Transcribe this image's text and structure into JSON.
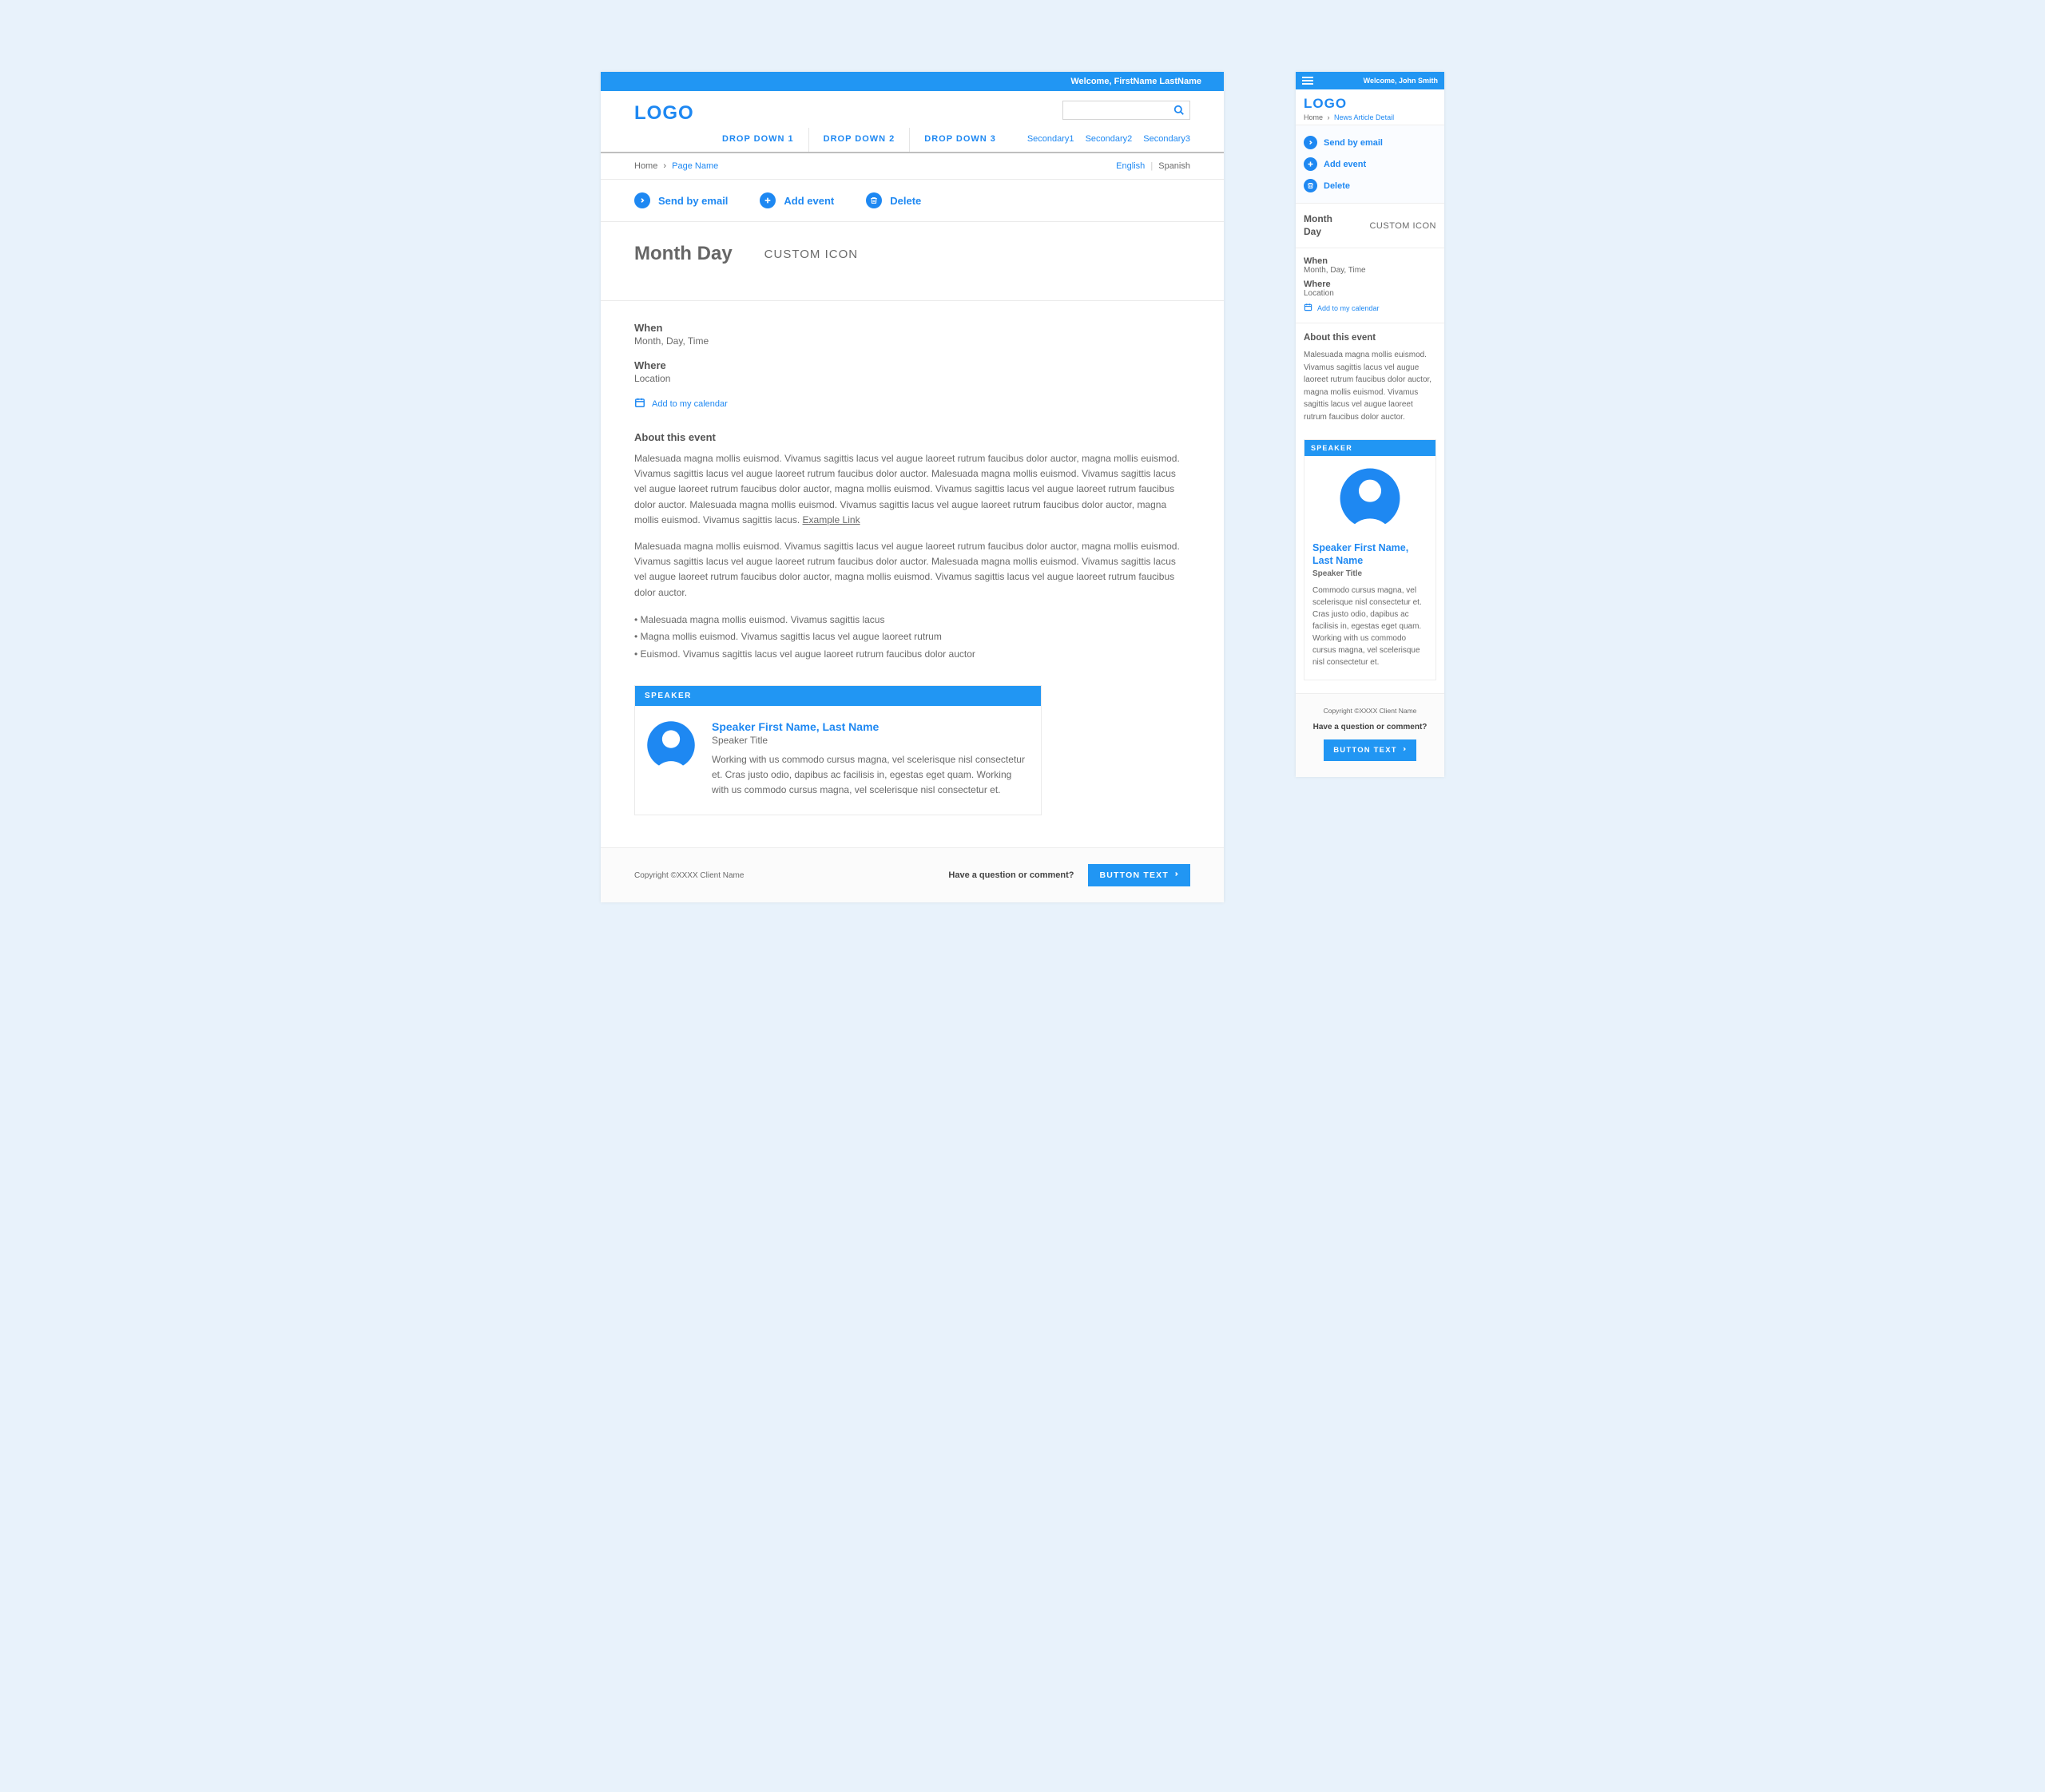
{
  "desktop": {
    "topbar_welcome": "Welcome, FirstName LastName",
    "logo": "LOGO",
    "search_placeholder": "",
    "primary_nav": [
      "DROP DOWN 1",
      "DROP DOWN 2",
      "DROP DOWN 3"
    ],
    "secondary_nav": [
      "Secondary1",
      "Secondary2",
      "Secondary3"
    ],
    "breadcrumb": {
      "home": "Home",
      "sep": "›",
      "page": "Page Name"
    },
    "lang": {
      "active": "English",
      "sep": "|",
      "inactive": "Spanish"
    },
    "actions": {
      "send_label": "Send by email",
      "add_label": "Add event",
      "delete_label": "Delete"
    },
    "title": "Month Day",
    "custom_icon": "CUSTOM ICON",
    "fields": {
      "when_label": "When",
      "when_value": "Month, Day, Time",
      "where_label": "Where",
      "where_value": "Location",
      "calendar_link": "Add to my calendar"
    },
    "about_heading": "About this event",
    "paragraph1": "Malesuada magna mollis euismod. Vivamus sagittis lacus vel augue laoreet rutrum faucibus dolor auctor, magna mollis euismod. Vivamus sagittis lacus vel augue laoreet rutrum faucibus dolor auctor. Malesuada magna mollis euismod. Vivamus sagittis lacus vel augue laoreet rutrum faucibus dolor auctor, magna mollis euismod. Vivamus sagittis lacus vel augue laoreet rutrum faucibus dolor auctor. Malesuada magna mollis euismod. Vivamus sagittis lacus vel augue laoreet rutrum faucibus dolor auctor, magna mollis euismod. Vivamus sagittis lacus. ",
    "paragraph1_link": "Example Link",
    "paragraph2": "Malesuada magna mollis euismod. Vivamus sagittis lacus vel augue laoreet rutrum faucibus dolor auctor, magna mollis euismod. Vivamus sagittis lacus vel augue laoreet rutrum faucibus dolor auctor. Malesuada magna mollis euismod. Vivamus sagittis lacus vel augue laoreet rutrum faucibus dolor auctor, magna mollis euismod. Vivamus sagittis lacus vel augue laoreet rutrum faucibus dolor auctor.",
    "bullets": [
      "Malesuada magna mollis euismod. Vivamus sagittis lacus",
      "Magna mollis euismod. Vivamus sagittis lacus vel augue laoreet rutrum",
      "Euismod. Vivamus sagittis lacus vel augue laoreet rutrum faucibus dolor auctor"
    ],
    "speaker": {
      "heading": "SPEAKER",
      "name": "Speaker First Name, Last Name",
      "title": "Speaker Title",
      "bio": "Working with us commodo cursus magna, vel scelerisque nisl consectetur et. Cras justo odio, dapibus ac facilisis in, egestas eget quam. Working with us commodo cursus magna, vel scelerisque nisl consectetur et."
    },
    "footer": {
      "copyright": "Copyright ©XXXX Client Name",
      "question": "Have a question or comment?",
      "button": "BUTTON TEXT"
    }
  },
  "mobile": {
    "topbar_welcome": "Welcome, John Smith",
    "logo": "LOGO",
    "breadcrumb": {
      "home": "Home",
      "sep": "›",
      "page": "News Article Detail"
    },
    "actions": {
      "send_label": "Send by email",
      "add_label": "Add event",
      "delete_label": "Delete"
    },
    "title": "Month Day",
    "custom_icon": "CUSTOM ICON",
    "fields": {
      "when_label": "When",
      "when_value": "Month, Day, Time",
      "where_label": "Where",
      "where_value": "Location",
      "calendar_link": "Add to my calendar"
    },
    "about_heading": "About this event",
    "about_text": "Malesuada magna mollis euismod. Vivamus sagittis lacus vel augue laoreet rutrum faucibus dolor auctor, magna mollis euismod. Vivamus sagittis lacus vel augue laoreet rutrum faucibus dolor auctor.",
    "speaker": {
      "heading": "SPEAKER",
      "name": "Speaker First Name, Last Name",
      "title": "Speaker Title",
      "bio": "Commodo cursus magna, vel scelerisque nisl consectetur et. Cras justo odio, dapibus ac facilisis in, egestas eget quam. Working with us commodo cursus magna, vel scelerisque nisl consectetur et."
    },
    "footer": {
      "copyright": "Copyright ©XXXX Client Name",
      "question": "Have a question or comment?",
      "button": "BUTTON TEXT"
    }
  }
}
